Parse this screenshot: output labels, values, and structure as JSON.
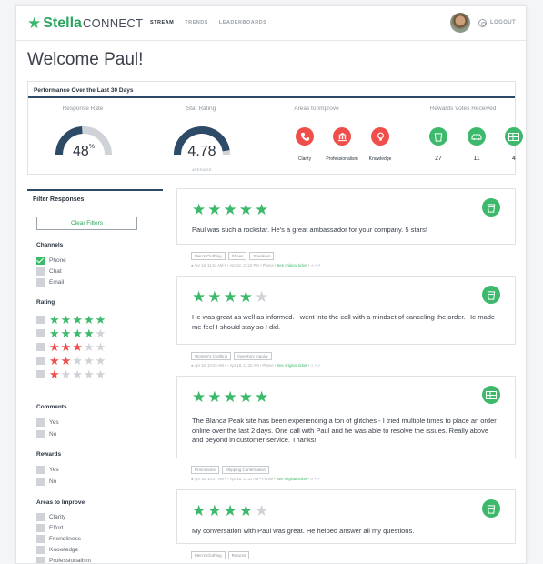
{
  "header": {
    "logo_star": "★",
    "logo_word": "Stella",
    "logo_suffix": "CONNECT",
    "nav": [
      "STREAM",
      "TRENDS",
      "LEADERBOARDS"
    ],
    "logout": "LOGOUT"
  },
  "welcome": "Welcome Paul!",
  "performance": {
    "title": "Performance Over the Last 30 Days",
    "response_rate_label": "Response Rate",
    "response_rate_value": "48",
    "response_rate_unit": "%",
    "response_rate_fraction": 0.48,
    "star_rating_label": "Star Rating",
    "star_rating_value": "4.78",
    "star_rating_sub": "AVERAGE",
    "star_rating_fraction": 0.95,
    "areas_label": "Areas to Improve",
    "areas": [
      {
        "label": "Clarity",
        "icon": "phone-icon"
      },
      {
        "label": "Professionalism",
        "icon": "bank-icon"
      },
      {
        "label": "Knowledge",
        "icon": "lightbulb-icon"
      }
    ],
    "rewards_label": "Rewards Votes Received",
    "rewards": [
      {
        "count": "27",
        "icon": "coffee-cup-icon"
      },
      {
        "count": "11",
        "icon": "car-icon"
      },
      {
        "count": "4",
        "icon": "gift-card-icon"
      }
    ],
    "colors": {
      "gauge": "#2d4a66",
      "gauge_track": "#cfd3d7",
      "area": "#ef4e4a",
      "reward": "#3cb96a"
    }
  },
  "filters": {
    "title": "Filter Responses",
    "clear": "Clear Filters",
    "channels_label": "Channels",
    "channels": [
      {
        "label": "Phone",
        "checked": true
      },
      {
        "label": "Chat",
        "checked": false
      },
      {
        "label": "Email",
        "checked": false
      }
    ],
    "rating_label": "Rating",
    "ratings": [
      5,
      4,
      3,
      2,
      1
    ],
    "comments_label": "Comments",
    "comments": [
      "Yes",
      "No"
    ],
    "rewards_label": "Rewards",
    "rewards": [
      "Yes",
      "No"
    ],
    "areas_label": "Areas to Improve",
    "areas": [
      "Clarity",
      "Effort",
      "Friendliness",
      "Knowledge",
      "Professionalism"
    ]
  },
  "reviews": [
    {
      "stars": 5,
      "text": "Paul was such a rockstar. He's a great ambassador for your company. 5 stars!",
      "badge_icon": "coffee-cup-icon",
      "tags": [
        "Men's Clothing",
        "Shoes",
        "Sneakers"
      ],
      "meta": "● Apr 18, 11:04 AM  •  ↑ Apr 18, 12:10 PM  •  Phone  •",
      "link": "See original ticket",
      "meta_end": "•  ⚠  •  ↗"
    },
    {
      "stars": 4,
      "text": "He was great as well as informed. I went into the call with a mindset of canceling the order. He made me feel I should stay so I did.",
      "badge_icon": "coffee-cup-icon",
      "tags": [
        "Women's Clothing",
        "Inventory Inquiry"
      ],
      "meta": "● Apr 18, 10:03 AM  •  ↑ Apr 18, 11:32 AM  •  Phone  •",
      "link": "See original ticket",
      "meta_end": "•  ⚠  •  ↗"
    },
    {
      "stars": 5,
      "text": "The Blanca Peak site has been experiencing a ton of glitches - I tried multiple times to place an order online over the last 2 days. One call with Paul and he was able to resolve the issues. Really above and beyond in customer service. Thanks!",
      "badge_icon": "gift-card-icon",
      "tags": [
        "Promotions",
        "Shipping Confirmation"
      ],
      "meta": "● Apr 18, 10:27 AM  •  ↑ Apr 18, 11:11 AM  •  Phone  •",
      "link": "See original ticket",
      "meta_end": "•  ⚠  •  ↗"
    },
    {
      "stars": 4,
      "text": "My conversation with Paul was great. He helped answer all my questions.",
      "badge_icon": "coffee-cup-icon",
      "tags": [
        "Men's Clothing",
        "Returns"
      ],
      "meta": "",
      "link": "",
      "meta_end": ""
    }
  ]
}
